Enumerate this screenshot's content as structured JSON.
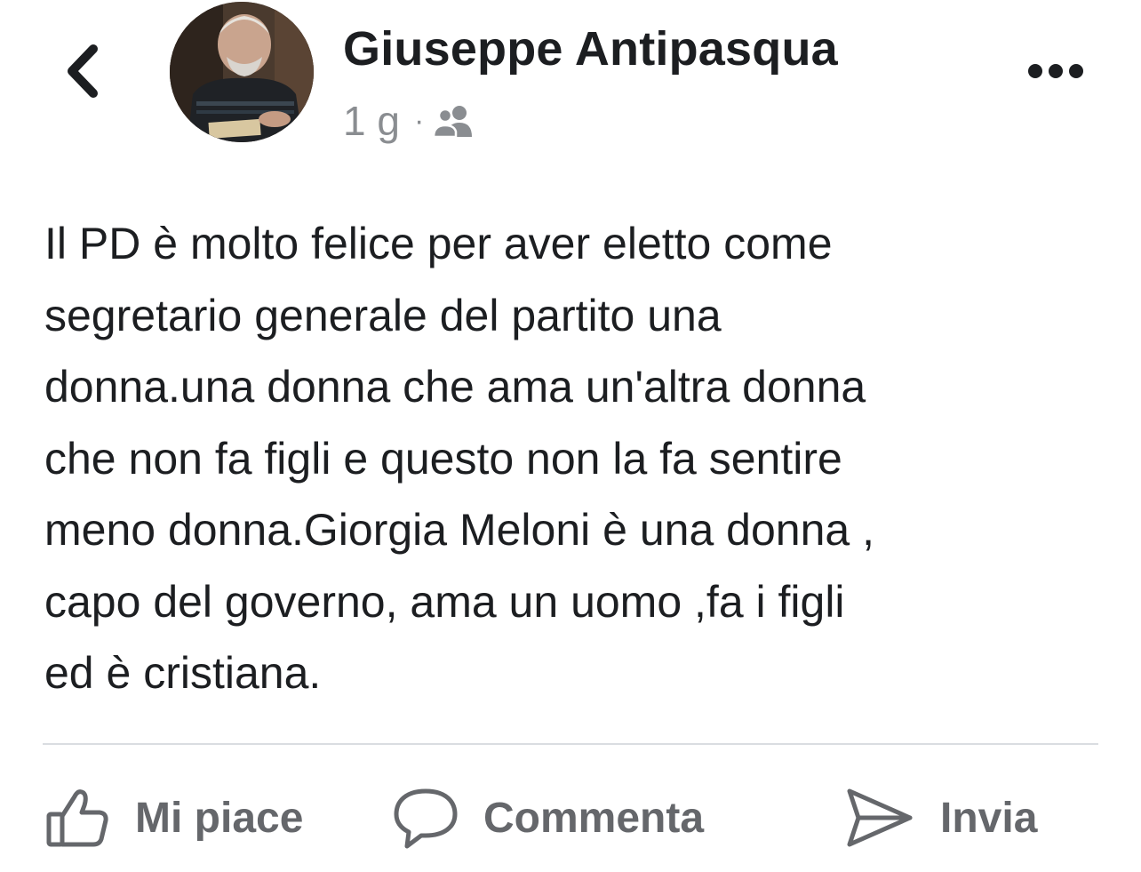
{
  "header": {
    "back_icon": "chevron-left-icon",
    "author_name": "Giuseppe Antipasqua",
    "timestamp": "1 g",
    "separator": "·",
    "audience_icon": "friends-icon",
    "more_icon": "ellipsis-icon"
  },
  "post": {
    "text": "Il PD è molto felice per aver eletto come\nsegretario generale del partito una\ndonna.una donna che ama un'altra donna\nche non fa figli  e questo non la fa sentire\nmeno donna.Giorgia Meloni è una donna ,\ncapo del governo, ama un uomo ,fa i figli\ned è cristiana."
  },
  "actions": {
    "like_label": "Mi piace",
    "like_icon": "thumbs-up-icon",
    "comment_label": "Commenta",
    "comment_icon": "speech-bubble-icon",
    "share_label": "Invia",
    "share_icon": "send-icon"
  },
  "colors": {
    "text": "#1c1e21",
    "secondary": "#65676b",
    "meta": "#8a8d91",
    "divider": "#dadde1"
  }
}
